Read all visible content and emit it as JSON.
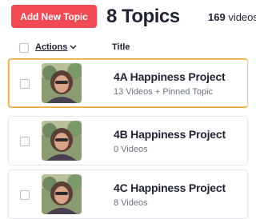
{
  "header": {
    "add_button_label": "Add New Topic",
    "topics_count": "8 Topics",
    "videos_count_number": "169",
    "videos_count_word": " videos"
  },
  "columns": {
    "actions_label": "Actions",
    "title_label": "Title"
  },
  "topics": [
    {
      "title": "4A Happiness Project",
      "subtitle": "13 Videos + Pinned Topic",
      "selected": true
    },
    {
      "title": "4B Happiness Project",
      "subtitle": "0 Videos",
      "selected": false
    },
    {
      "title": "4C Happiness Project",
      "subtitle": "8 Videos",
      "selected": false
    }
  ],
  "colors": {
    "accent": "#f24a55",
    "selected_border": "#f5a33b"
  },
  "icons": {
    "actions_dropdown": "chevron-down-icon"
  }
}
